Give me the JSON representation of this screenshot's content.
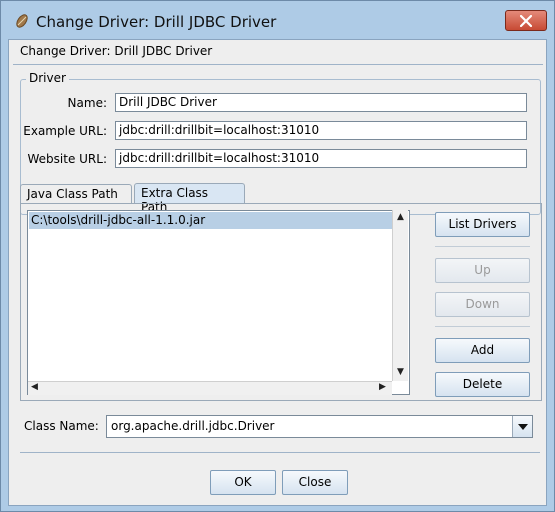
{
  "window": {
    "title": "Change Driver: Drill JDBC Driver",
    "icon": "driver-icon",
    "close_icon": "close-icon"
  },
  "dialog": {
    "header": "Change Driver: Drill JDBC Driver"
  },
  "driver_group": {
    "title": "Driver",
    "name_label": "Name:",
    "name_value": "Drill JDBC Driver",
    "example_url_label": "Example URL:",
    "example_url_value": "jdbc:drill:drillbit=localhost:31010",
    "website_url_label": "Website URL:",
    "website_url_value": "jdbc:drill:drillbit=localhost:31010"
  },
  "tabs": [
    {
      "label": "Java Class Path",
      "active": false
    },
    {
      "label": "Extra Class Path",
      "active": true
    }
  ],
  "class_path_list": {
    "items": [
      "C:\\tools\\drill-jdbc-all-1.1.0.jar"
    ],
    "selected_index": 0
  },
  "side_buttons": {
    "list_drivers": "List Drivers",
    "up": "Up",
    "down": "Down",
    "add": "Add",
    "delete": "Delete"
  },
  "class_name": {
    "label": "Class Name:",
    "value": "org.apache.drill.jdbc.Driver"
  },
  "footer": {
    "ok": "OK",
    "close": "Close"
  },
  "colors": {
    "title_bar": "#aecbe6",
    "dialog_bg": "#eeeeee",
    "selection": "#b8cfe5",
    "close_button": "#c74a34"
  }
}
